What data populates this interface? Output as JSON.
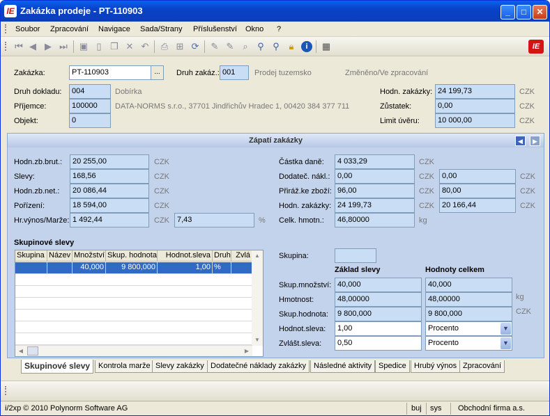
{
  "window": {
    "title": "Zakázka prodeje - PT-110903",
    "logo": "IE",
    "buttons": [
      "_",
      "□",
      "✕"
    ]
  },
  "menu": [
    "Soubor",
    "Zpracování",
    "Navigace",
    "Sada/Strany",
    "Příslušenství",
    "Okno",
    "?"
  ],
  "toolbar": {
    "brand": "IE",
    "icons": [
      "first-icon",
      "prev-icon",
      "next-icon",
      "last-icon",
      "save-icon",
      "new-icon",
      "copy-icon",
      "delete-icon",
      "undo-icon",
      "print-icon",
      "tree-icon",
      "refresh-icon",
      "edit-icon",
      "edit2-icon",
      "find-icon",
      "zoom-icon",
      "zoom2-icon",
      "lock-icon",
      "info-icon",
      "calc-icon"
    ]
  },
  "header": {
    "zakazka_label": "Zakázka:",
    "zakazka_value": "PT-110903",
    "druh_zakaz_label": "Druh zakáz.:",
    "druh_zakaz_value": "001",
    "druh_zakaz_text": "Prodej tuzemsko",
    "state_text": "Změněno/Ve zpracování",
    "druh_dokladu_label": "Druh dokladu:",
    "druh_dokladu_value": "004",
    "druh_dokladu_text": "Dobírka",
    "prijemce_label": "Příjemce:",
    "prijemce_value": "100000",
    "prijemce_text": "DATA-NORMS s.r.o., 37701 Jindřichův Hradec 1, 00420 384 377 711",
    "objekt_label": "Objekt:",
    "objekt_value": "0",
    "hodn_label": "Hodn. zakázky:",
    "hodn_value": "24 199,73",
    "hodn_cur": "CZK",
    "zustatek_label": "Zůstatek:",
    "zustatek_value": "0,00",
    "zustatek_cur": "CZK",
    "limit_label": "Limit úvěru:",
    "limit_value": "10 000,00",
    "limit_cur": "CZK"
  },
  "panel": {
    "title": "Zápatí zakázky",
    "left": {
      "hodn_brut_label": "Hodn.zb.brut.:",
      "hodn_brut_value": "20 255,00",
      "hodn_brut_cur": "CZK",
      "slevy_label": "Slevy:",
      "slevy_value": "168,56",
      "slevy_cur": "CZK",
      "hodn_net_label": "Hodn.zb.net.:",
      "hodn_net_value": "20 086,44",
      "hodn_net_cur": "CZK",
      "porizeni_label": "Pořízení:",
      "porizeni_value": "18 594,00",
      "porizeni_cur": "CZK",
      "hr_vynos_label": "Hr.výnos/Marže:",
      "hr_vynos_value": "1 492,44",
      "hr_vynos_cur": "CZK",
      "marze_value": "7,43",
      "marze_unit": "%"
    },
    "right": {
      "castka_dane_label": "Částka daně:",
      "castka_dane_value": "4 033,29",
      "castka_dane_cur": "CZK",
      "dodatec_label": "Dodateč. nákl.:",
      "dodatec_value": "0,00",
      "dodatec_cur": "CZK",
      "dodatec_value2": "0,00",
      "dodatec_cur2": "CZK",
      "priraz_label": "Přiráž.ke zboží:",
      "priraz_value": "96,00",
      "priraz_cur": "CZK",
      "priraz_value2": "80,00",
      "priraz_cur2": "CZK",
      "hodn_zak_label": "Hodn. zakázky:",
      "hodn_zak_value": "24 199,73",
      "hodn_zak_cur": "CZK",
      "hodn_zak_value2": "20 166,44",
      "hodn_zak_cur2": "CZK",
      "celk_hmotn_label": "Celk. hmotn.:",
      "celk_hmotn_value": "46,80000",
      "celk_hmotn_unit": "kg"
    },
    "grid": {
      "title": "Skupinové slevy",
      "columns": [
        "Skupina",
        "Název",
        "Množství",
        "Skup. hodnota",
        "Hodnot.sleva",
        "Druh",
        "Zvlá"
      ],
      "rows": [
        [
          "",
          "",
          "40,000",
          "9 800,000",
          "1,00",
          "%",
          ""
        ]
      ]
    },
    "group": {
      "skupina_label": "Skupina:",
      "skupina_value": "",
      "col1": "Základ slevy",
      "col2": "Hodnoty celkem",
      "mnozstvi_label": "Skup.množství:",
      "mnozstvi_v1": "40,000",
      "mnozstvi_v2": "40,000",
      "hmotnost_label": "Hmotnost:",
      "hmotnost_v1": "48,00000",
      "hmotnost_v2": "48,00000",
      "hmotnost_unit": "kg",
      "hodnota_label": "Skup.hodnota:",
      "hodnota_v1": "9 800,000",
      "hodnota_v2": "9 800,000",
      "hodnota_unit": "CZK",
      "sleva_label": "Hodnot.sleva:",
      "sleva_v1": "1,00",
      "sleva_v2": "Procento",
      "zvlast_label": "Zvlášt.sleva:",
      "zvlast_v1": "0,50",
      "zvlast_v2": "Procento"
    }
  },
  "tabs": [
    "Skupinové slevy",
    "Kontrola marže",
    "Slevy zakázky",
    "Dodatečné náklady zakázky",
    "Následné aktivity",
    "Spedice",
    "Hrubý výnos",
    "Zpracování"
  ],
  "status": {
    "copyright": "i/2xp © 2010 Polynorm Software AG",
    "user": "buj",
    "system": "sys",
    "company": "Obchodní firma a.s."
  }
}
